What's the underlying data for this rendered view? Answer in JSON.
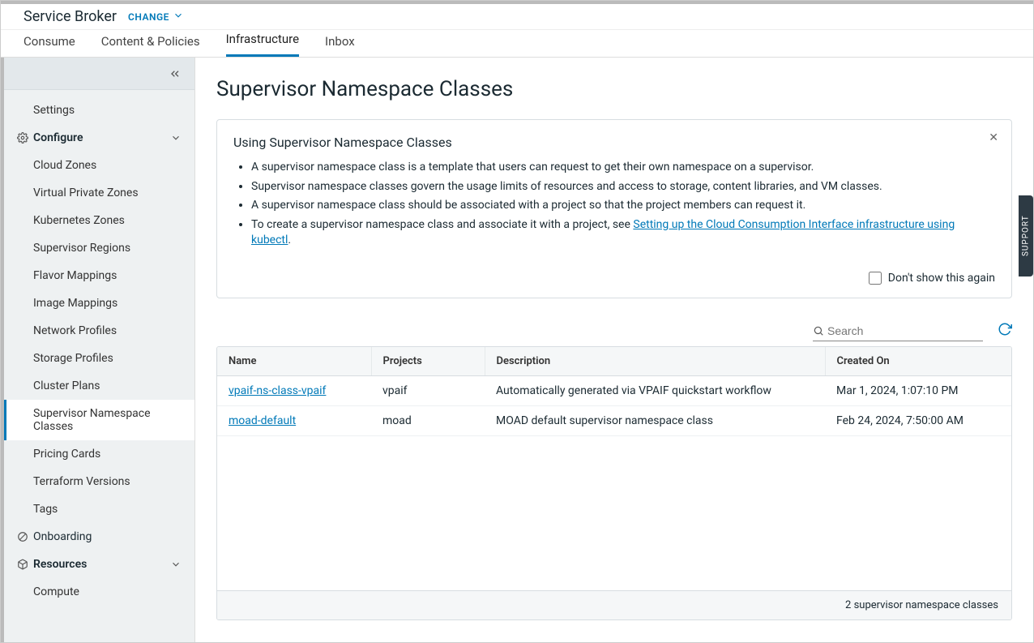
{
  "header": {
    "product": "Service Broker",
    "changeLabel": "CHANGE"
  },
  "tabs": [
    {
      "id": "consume",
      "label": "Consume",
      "active": false
    },
    {
      "id": "content",
      "label": "Content & Policies",
      "active": false
    },
    {
      "id": "infra",
      "label": "Infrastructure",
      "active": true
    },
    {
      "id": "inbox",
      "label": "Inbox",
      "active": false
    }
  ],
  "sidebar": {
    "settings": "Settings",
    "configure": "Configure",
    "configureItems": [
      "Cloud Zones",
      "Virtual Private Zones",
      "Kubernetes Zones",
      "Supervisor Regions",
      "Flavor Mappings",
      "Image Mappings",
      "Network Profiles",
      "Storage Profiles",
      "Cluster Plans",
      "Supervisor Namespace Classes",
      "Pricing Cards",
      "Terraform Versions",
      "Tags"
    ],
    "activeIndex": 9,
    "onboarding": "Onboarding",
    "resources": "Resources",
    "resourcesItems": [
      "Compute"
    ]
  },
  "page": {
    "title": "Supervisor Namespace Classes",
    "info": {
      "heading": "Using Supervisor Namespace Classes",
      "bullets": [
        "A supervisor namespace class is a template that users can request to get their own namespace on a supervisor.",
        "Supervisor namespace classes govern the usage limits of resources and access to storage, content libraries, and VM classes.",
        "A supervisor namespace class should be associated with a project so that the project members can request it."
      ],
      "lastBulletPrefix": "To create a supervisor namespace class and associate it with a project, see ",
      "lastBulletLink": "Setting up the Cloud Consumption Interface infrastructure using kubectl",
      "lastBulletSuffix": ".",
      "dontShow": "Don't show this again"
    },
    "search": {
      "placeholder": "Search"
    },
    "columns": [
      "Name",
      "Projects",
      "Description",
      "Created On"
    ],
    "rows": [
      {
        "name": "vpaif-ns-class-vpaif",
        "projects": "vpaif",
        "description": "Automatically generated via VPAIF quickstart workflow",
        "created": "Mar 1, 2024, 1:07:10 PM"
      },
      {
        "name": "moad-default",
        "projects": "moad",
        "description": "MOAD default supervisor namespace class",
        "created": "Feb 24, 2024, 7:50:00 AM"
      }
    ],
    "footer": "2 supervisor namespace classes"
  },
  "support": "SUPPORT"
}
